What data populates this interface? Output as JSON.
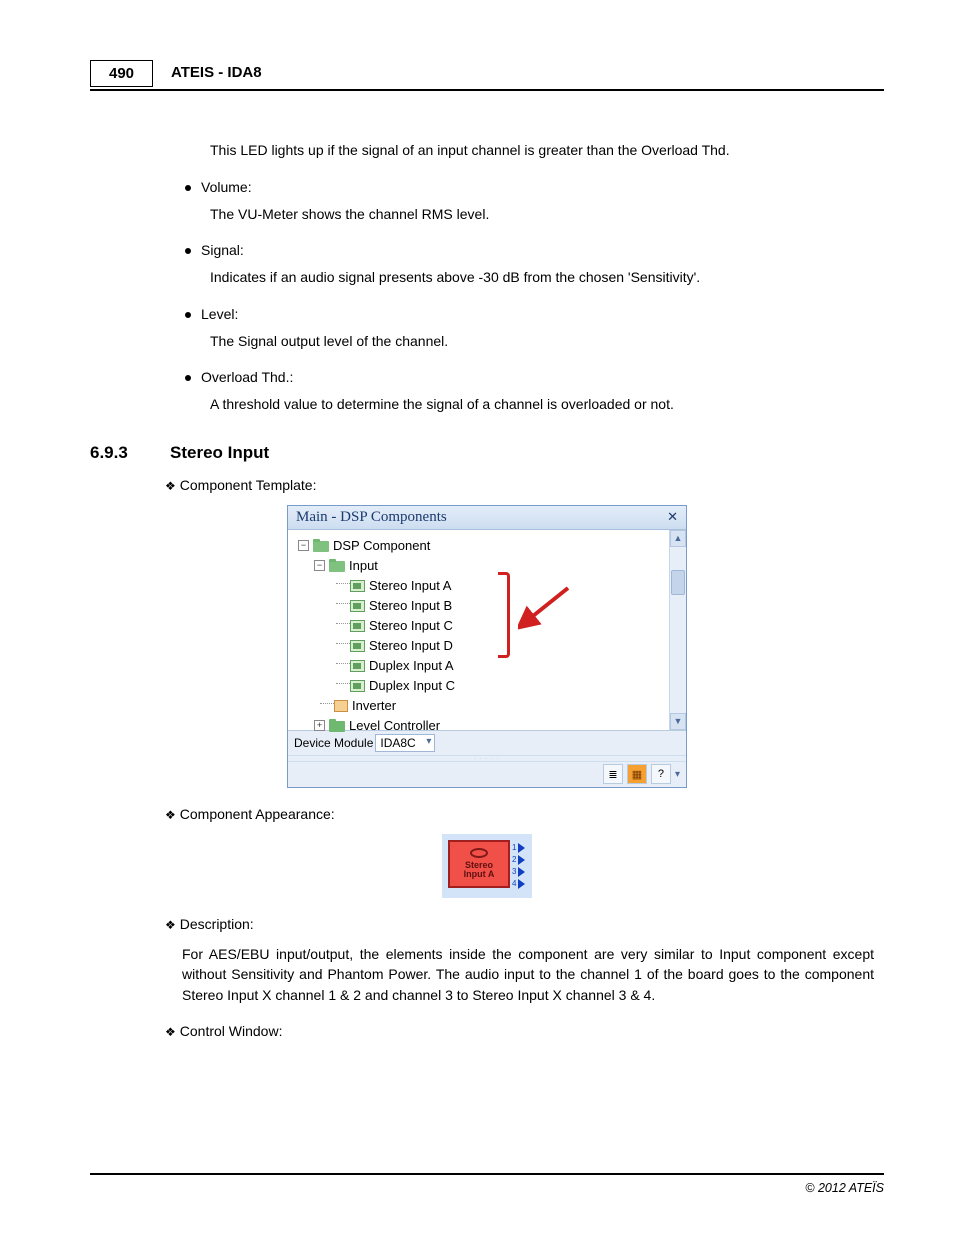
{
  "header": {
    "page_num": "490",
    "title": "ATEIS - IDA8"
  },
  "intro_text": "This LED lights up if the signal of an input channel is greater than the Overload Thd.",
  "bullets": [
    {
      "label": "Volume:",
      "desc": "The VU-Meter shows the channel RMS level."
    },
    {
      "label": "Signal:",
      "desc": "Indicates if an audio signal presents above -30 dB from the chosen 'Sensitivity'."
    },
    {
      "label": "Level:",
      "desc": "The Signal output level of the channel."
    },
    {
      "label": "Overload Thd.:",
      "desc": "A threshold value to determine the signal of a channel is overloaded or not."
    }
  ],
  "section": {
    "num": "6.9.3",
    "title": "Stereo Input"
  },
  "sub1": "Component Template:",
  "tree": {
    "title": "Main - DSP Components",
    "root": "DSP Component",
    "input": "Input",
    "items": [
      "Stereo Input A",
      "Stereo Input B",
      "Stereo Input C",
      "Stereo Input D",
      "Duplex Input A",
      "Duplex Input C"
    ],
    "inverter": "Inverter",
    "level": "Level Controller",
    "footer_label": "Device Module",
    "footer_value": "IDA8C"
  },
  "sub2": "Component Appearance:",
  "component": {
    "line1": "Stereo",
    "line2": "Input A",
    "ports": [
      "1",
      "2",
      "3",
      "4"
    ]
  },
  "sub3": "Description:",
  "description": "For AES/EBU input/output, the elements inside the component are very similar to Input component except without Sensitivity and Phantom Power. The audio input to the channel 1 of the board goes to the component Stereo Input X channel 1 & 2 and channel 3 to Stereo Input X channel 3 & 4.",
  "sub4": "Control Window:",
  "footer": "© 2012 ATEÏS"
}
